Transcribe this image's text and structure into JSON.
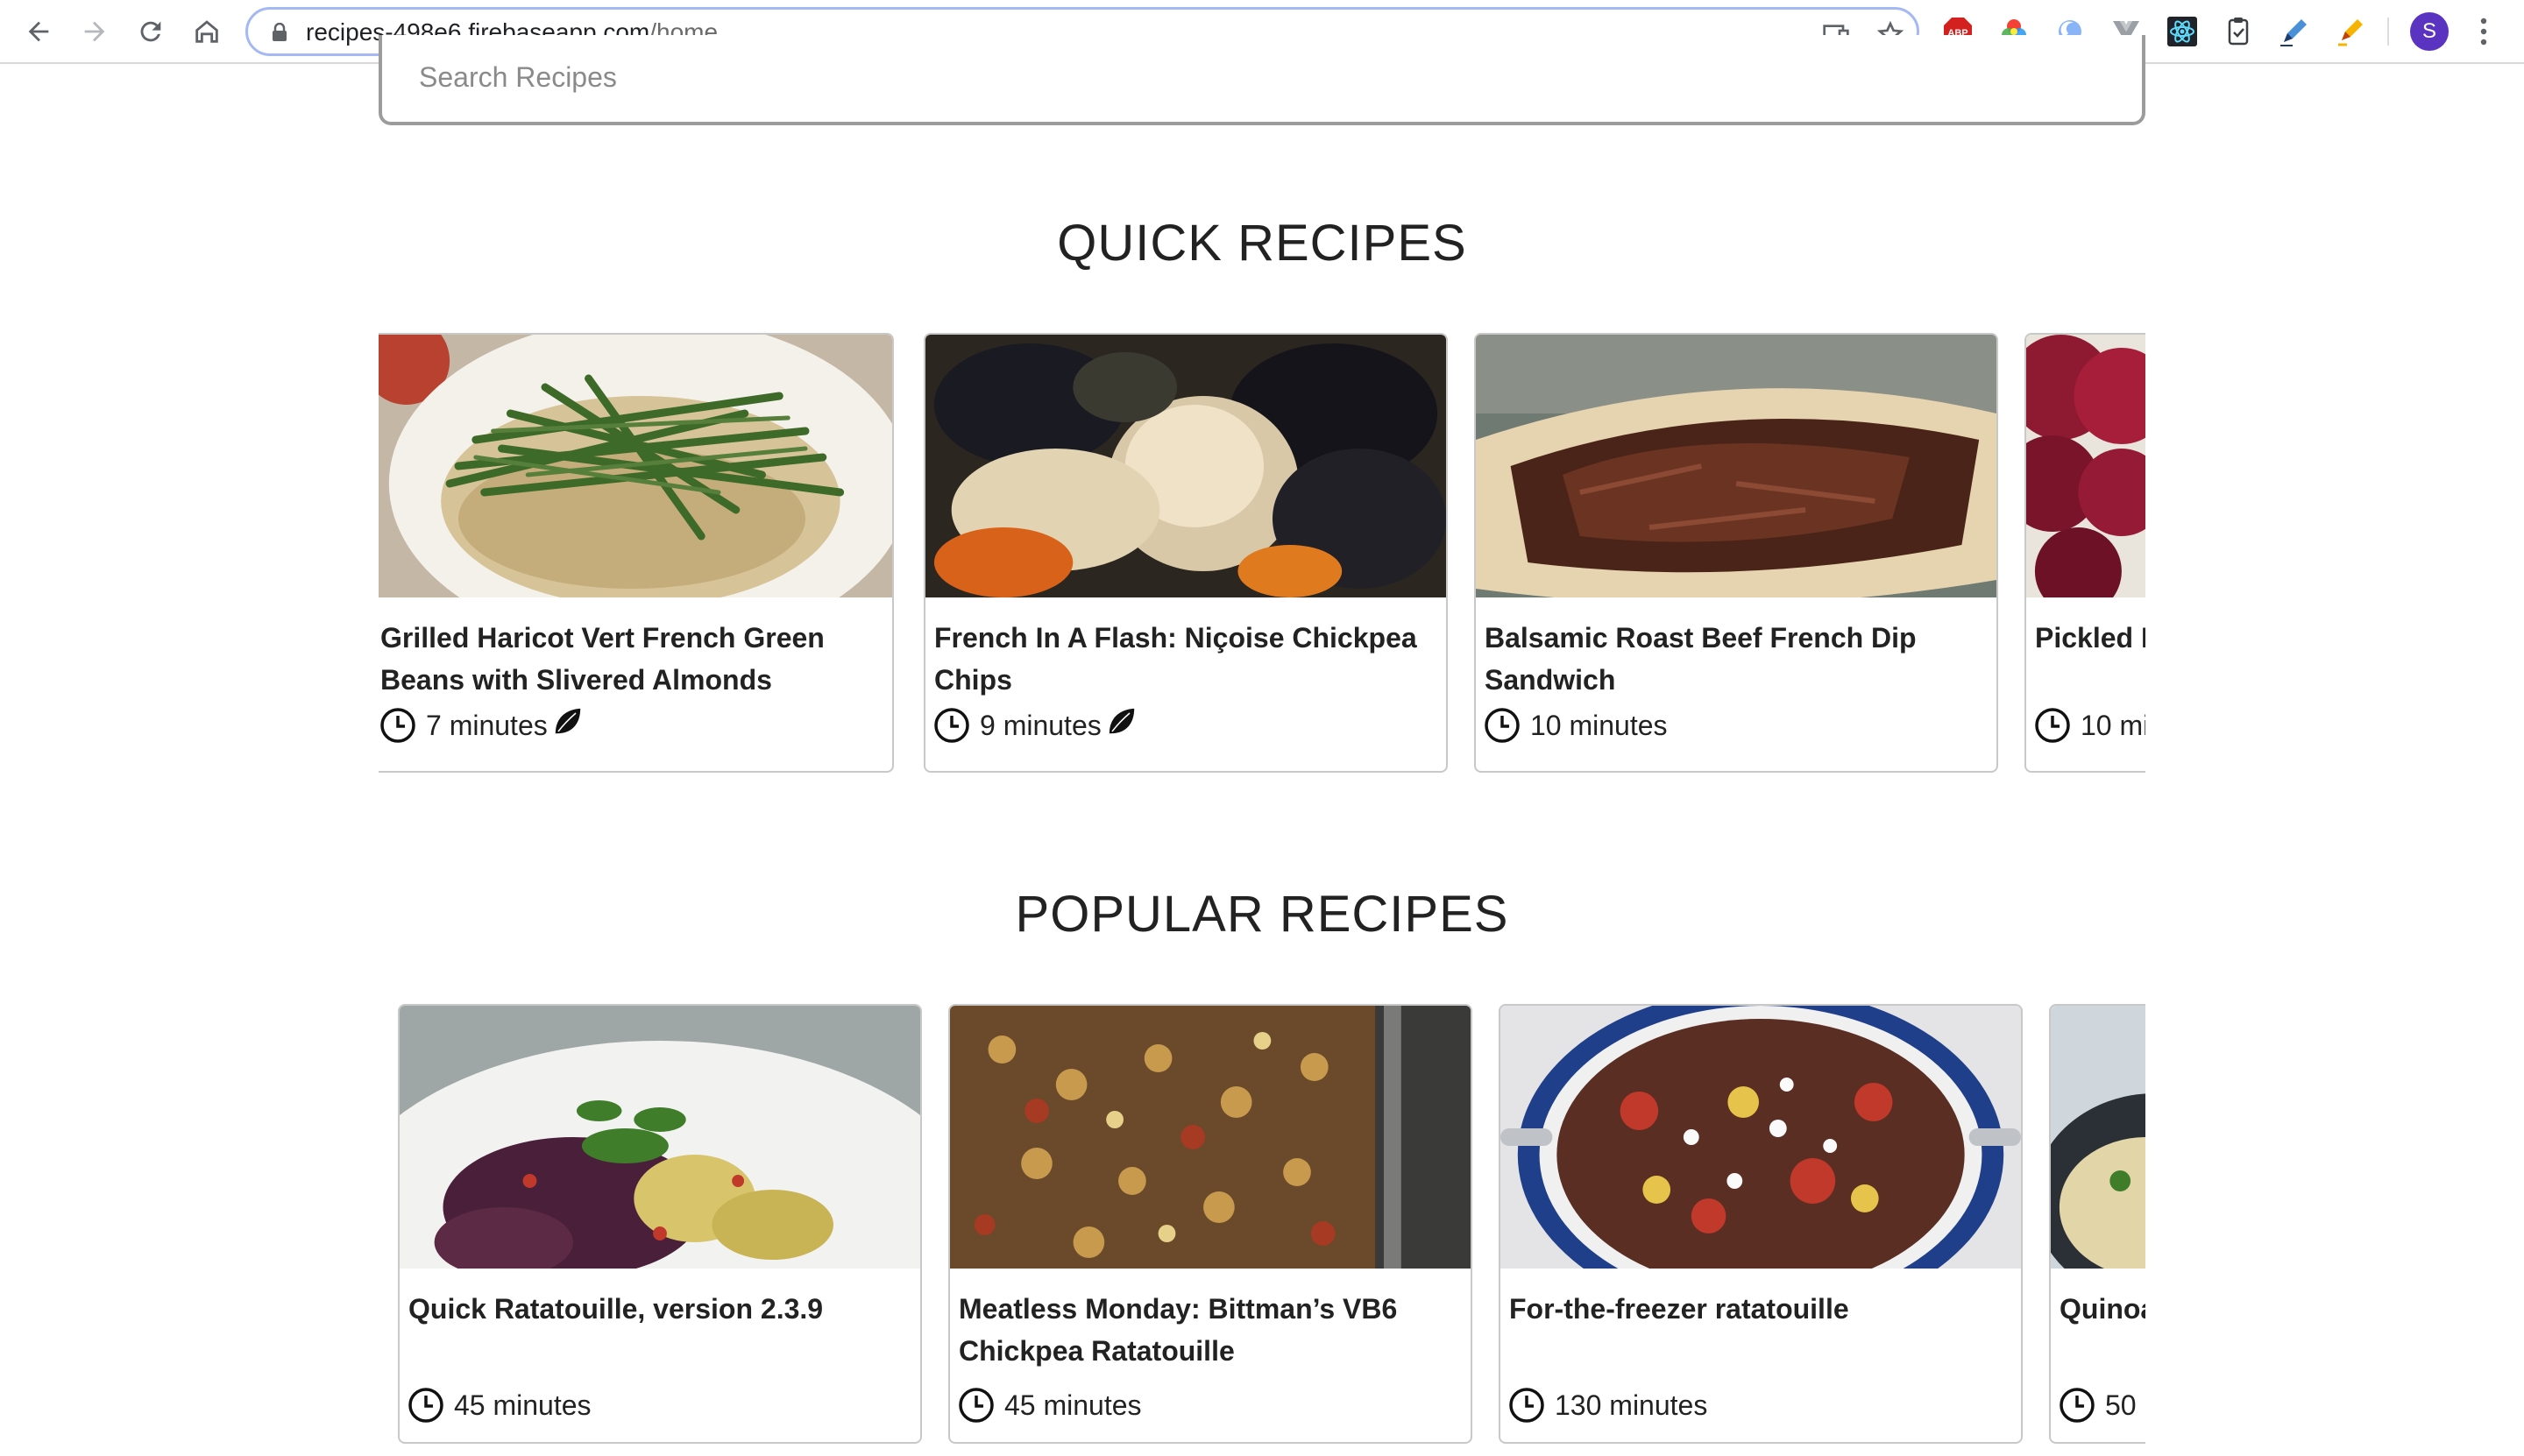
{
  "browser": {
    "url_host": "recipes-498e6.firebaseapp.com",
    "url_path": "/home",
    "profile_initial": "S",
    "extensions": [
      "adblock-icon",
      "color-wheel-icon",
      "edge-swirl-icon",
      "vue-devtools-icon",
      "react-devtools-icon",
      "clipboard-icon",
      "pen-icon",
      "highlighter-icon"
    ]
  },
  "search": {
    "placeholder": "Search Recipes"
  },
  "quick": {
    "heading": "QUICK RECIPES",
    "cards": [
      {
        "title": "Grilled Haricot Vert French Green Beans with Slivered Almonds",
        "time": "7 minutes",
        "vegetarian": true
      },
      {
        "title": "French In A Flash: Niçoise Chickpea Chips",
        "time": "9 minutes",
        "vegetarian": true
      },
      {
        "title": "Balsamic Roast Beef French Dip Sandwich",
        "time": "10 minutes",
        "vegetarian": false
      },
      {
        "title": "Pickled E",
        "time": "10 mi",
        "vegetarian": false
      }
    ]
  },
  "popular": {
    "heading": "POPULAR RECIPES",
    "cards": [
      {
        "title": "Quick Ratatouille, version 2.3.9",
        "time": "45 minutes"
      },
      {
        "title": "Meatless Monday: Bittman’s VB6 Chickpea Ratatouille",
        "time": "45 minutes"
      },
      {
        "title": "For-the-freezer ratatouille",
        "time": "130 minutes"
      },
      {
        "title": "Quinoa",
        "time": "50"
      }
    ]
  },
  "colors": {
    "card_border": "#c8c8c8",
    "search_border": "#9c9c9c",
    "omnibox_focus": "#a4b9f3",
    "avatar": "#5a34c0"
  }
}
